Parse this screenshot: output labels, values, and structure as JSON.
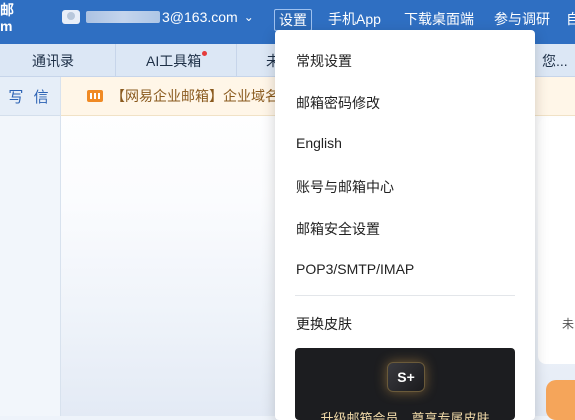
{
  "header": {
    "logo": "邮\nm",
    "user_email_suffix": "3@163.com",
    "nav": [
      {
        "label": "设置"
      },
      {
        "label": "手机App"
      },
      {
        "label": "下载桌面端"
      },
      {
        "label": "参与调研"
      },
      {
        "label": "自"
      }
    ]
  },
  "tabs": [
    {
      "label": "通讯录"
    },
    {
      "label": "AI工具箱"
    },
    {
      "label": "未"
    },
    {
      "label": "您..."
    }
  ],
  "sidebar": {
    "write_label": "写 信"
  },
  "notice": {
    "text": "【网易企业邮箱】企业域名"
  },
  "card": {
    "text": "未"
  },
  "settings_menu": {
    "items": [
      {
        "label": "常规设置"
      },
      {
        "label": "邮箱密码修改"
      },
      {
        "label": "English"
      },
      {
        "label": "账号与邮箱中心"
      },
      {
        "label": "邮箱安全设置"
      },
      {
        "label": "POP3/SMTP/IMAP"
      },
      {
        "label": "更换皮肤"
      }
    ],
    "promo": {
      "badge": "S+",
      "text": "升级邮箱会员，尊享专属皮肤"
    }
  },
  "colors": {
    "header_blue": "#2f6fc2",
    "accent_orange": "#f08a24"
  }
}
